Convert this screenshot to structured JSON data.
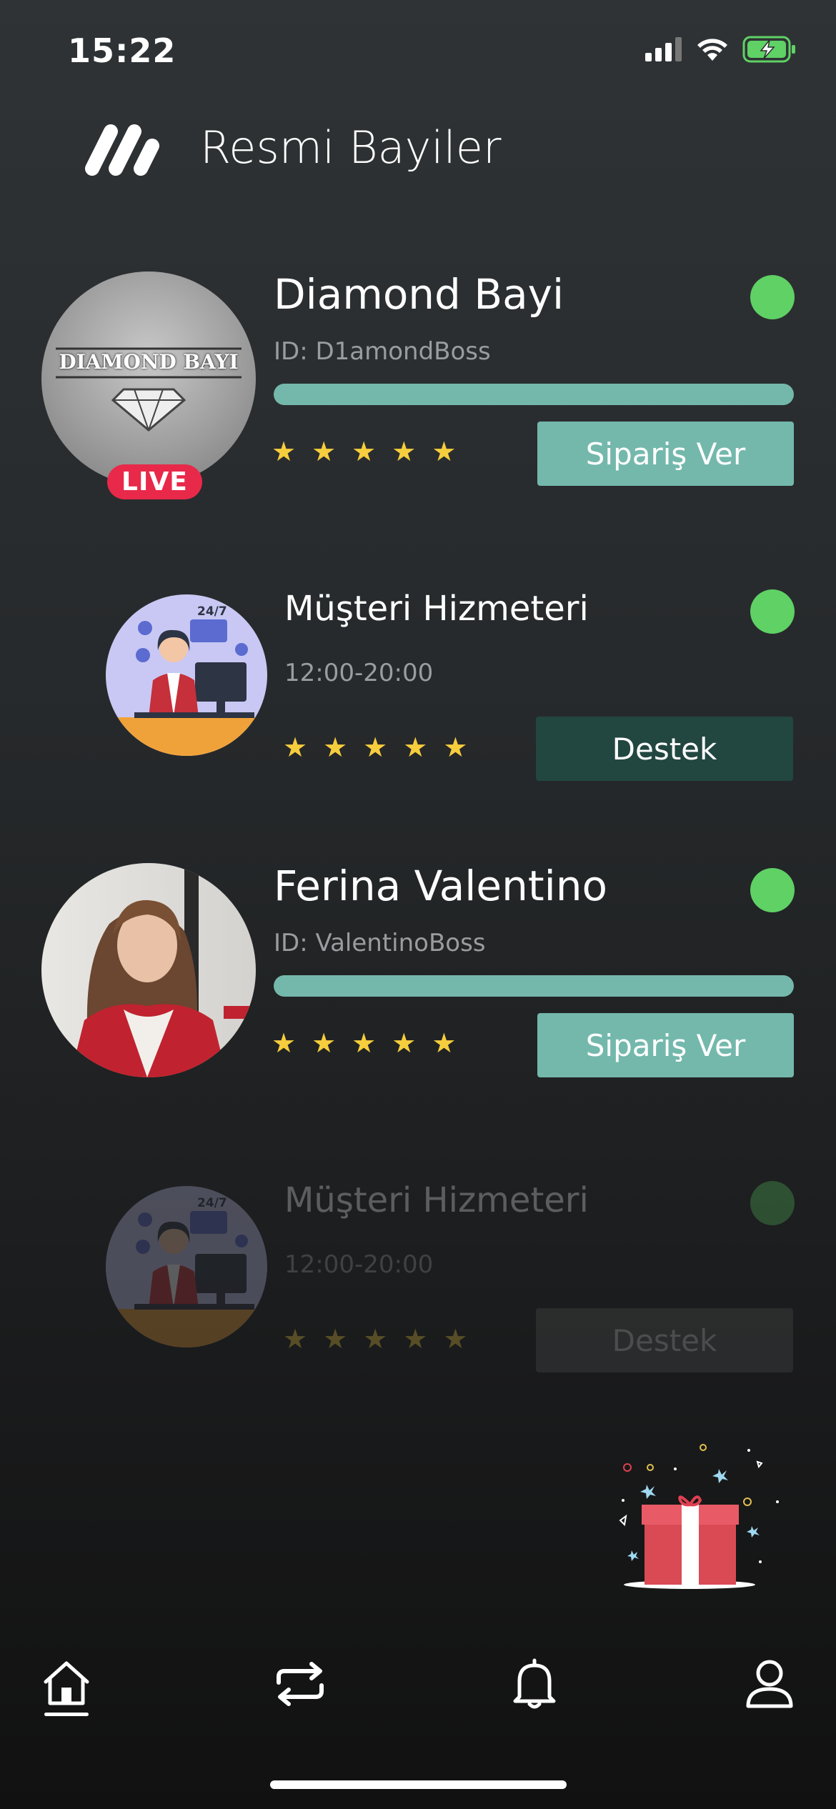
{
  "status_bar": {
    "time": "15:22"
  },
  "header": {
    "title": "Resmi Bayiler"
  },
  "cards": [
    {
      "name": "Diamond Bayi",
      "subtitle": "ID: D1amondBoss",
      "badge": "LIVE",
      "avatar_text": "DIAMOND BAYI",
      "online": true,
      "rating": 5,
      "stars": [
        "★",
        "★",
        "★",
        "★",
        "★"
      ],
      "progress": 1.0,
      "button_label": "Sipariş Ver"
    },
    {
      "name": "Müşteri Hizmeteri",
      "subtitle": "12:00-20:00",
      "avatar_text": "24/7",
      "online": true,
      "rating": 5,
      "stars": [
        "★",
        "★",
        "★",
        "★",
        "★"
      ],
      "button_label": "Destek"
    },
    {
      "name": "Ferina Valentino",
      "subtitle": "ID: ValentinoBoss",
      "online": true,
      "rating": 5,
      "stars": [
        "★",
        "★",
        "★",
        "★",
        "★"
      ],
      "progress": 1.0,
      "button_label": "Sipariş Ver"
    },
    {
      "name": "Müşteri Hizmeteri",
      "subtitle": "12:00-20:00",
      "avatar_text": "24/7",
      "online": true,
      "rating": 5,
      "stars": [
        "★",
        "★",
        "★",
        "★",
        "★"
      ],
      "button_label": "Destek",
      "dimmed": true
    }
  ],
  "bottom_nav": {
    "items": [
      {
        "icon": "home-icon",
        "active": true
      },
      {
        "icon": "swap-icon",
        "active": false
      },
      {
        "icon": "bell-icon",
        "active": false
      },
      {
        "icon": "profile-icon",
        "active": false
      }
    ]
  },
  "colors": {
    "accent": "#74b8ac",
    "support_button": "#214740",
    "online_dot": "#5fd165",
    "star": "#f6cd3d",
    "live": "#e8294a"
  }
}
